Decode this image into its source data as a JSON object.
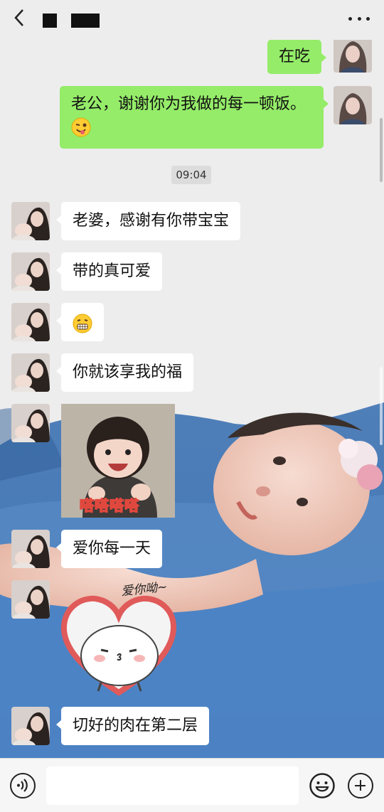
{
  "colors": {
    "outgoing_bubble": "#95ec69",
    "incoming_bubble": "#ffffff",
    "chat_background": "#ededed"
  },
  "header": {
    "back_icon": "chevron-left-icon",
    "title": "",
    "more_icon": "ellipsis-icon"
  },
  "messages": {
    "m1": {
      "text": "在吃"
    },
    "m2": {
      "text": "老公，谢谢你为我做的每一顿饭。",
      "emoji": "wink-tongue-emoji"
    },
    "time": "09:04",
    "m3": {
      "text": "老婆，感谢有你带宝宝"
    },
    "m4": {
      "text": "带的真可爱"
    },
    "m5": {
      "emoji": "grimace-emoji"
    },
    "m6": {
      "text": "你就该享我的福"
    },
    "m7": {
      "sticker_caption": "嗒嗒嗒嗒"
    },
    "m8": {
      "text": "爱你每一天"
    },
    "m9": {
      "sticker_caption": "爱你呦~"
    },
    "m10": {
      "text": "切好的肉在第二层"
    }
  },
  "inputbar": {
    "voice_icon": "voice-icon",
    "emoji_icon": "smile-icon",
    "plus_icon": "plus-icon",
    "value": ""
  }
}
